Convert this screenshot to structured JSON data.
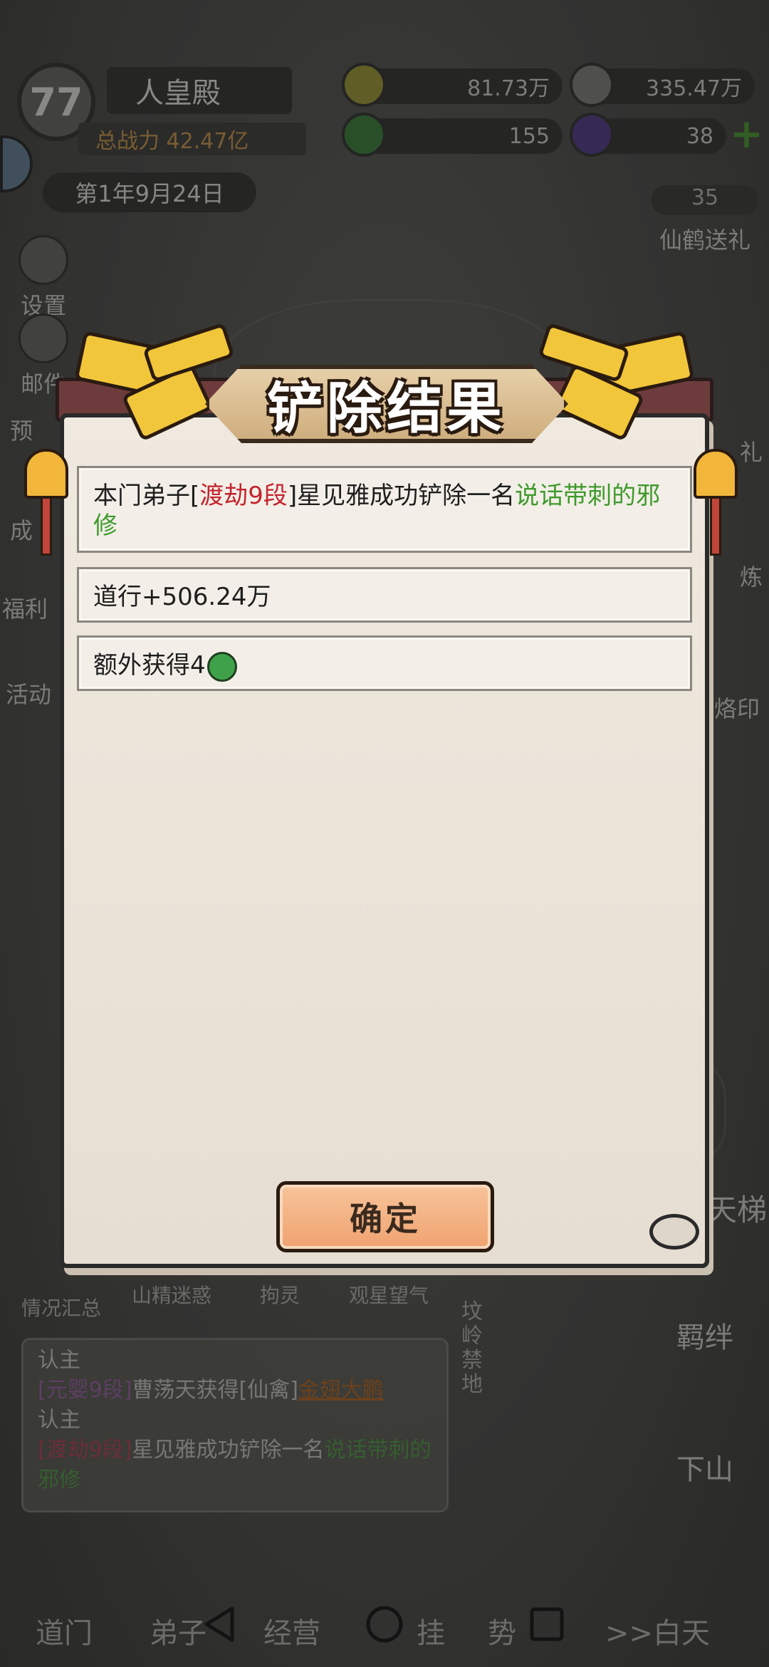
{
  "top": {
    "level": "77",
    "palace_name": "人皇殿",
    "power_label": "总战力 42.47亿",
    "coins": "81.73万",
    "gourd_amount": "335.47万",
    "jade": "155",
    "purple_amount": "38",
    "plus_symbol": "+",
    "date": "第1年9月24日"
  },
  "side_left": [
    {
      "label": "设置"
    },
    {
      "label": "邮件"
    },
    {
      "label": "预"
    },
    {
      "label": "成"
    },
    {
      "label": "福利"
    },
    {
      "label": "活动"
    }
  ],
  "side_right": {
    "crane_count": "35",
    "crane_label": "仙鹤送礼",
    "li_label": "礼",
    "lian_label": "炼",
    "seal_label": "烙印",
    "ladder_label": "天梯",
    "bond_label": "羁绊",
    "descend_label": "下山"
  },
  "bottom_strip": {
    "items": [
      "情况汇总",
      "山精迷惑",
      "拘灵",
      "观星望气"
    ],
    "tomb_label": "坟岭禁地"
  },
  "log": {
    "line1_tail": "认主",
    "line2_rank": "[元婴9段]",
    "line2_text": "曹荡天获得[仙禽]",
    "line2_item": "金翅大鹏",
    "line2_tail": "认主",
    "line3_rank": "[渡劫9段]",
    "line3_text": "星见雅成功铲除一名",
    "line3_target": "说话带刺的邪修"
  },
  "bottom_tabs": [
    "道门",
    "弟子",
    "经营",
    "挂",
    "势",
    ">>白天"
  ],
  "modal": {
    "title": "铲除结果",
    "msg1_prefix": "本门弟子[",
    "msg1_rank": "渡劫9段",
    "msg1_middle": "]星见雅成功铲除一名",
    "msg1_target": "说话带刺的邪修",
    "msg2": "道行+506.24万",
    "msg3": "额外获得4",
    "confirm": "确定"
  },
  "colors": {
    "accent_red": "#c4232d",
    "accent_green": "#3f9a2c",
    "button": "#f0a270",
    "header_bar": "#6e3b3c"
  }
}
